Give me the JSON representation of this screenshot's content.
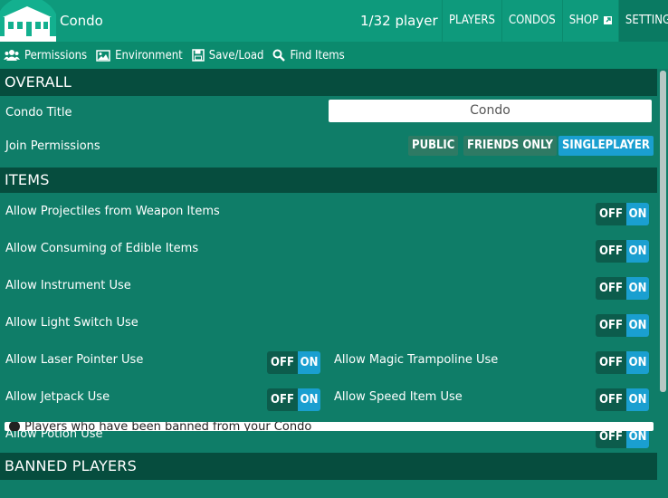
{
  "header": {
    "brand": "Condo",
    "player_count": "1/32 player",
    "nav": [
      "PLAYERS",
      "CONDOS",
      "SHOP",
      "SETTINGS"
    ]
  },
  "tabs": [
    {
      "icon": "users-icon",
      "label": "Permissions"
    },
    {
      "icon": "image-icon",
      "label": "Environment"
    },
    {
      "icon": "save-icon",
      "label": "Save/Load"
    },
    {
      "icon": "search-icon",
      "label": "Find Items"
    }
  ],
  "sections": {
    "overall": "OVERALL",
    "items": "ITEMS",
    "banned": "BANNED PLAYERS"
  },
  "overall": {
    "condo_title_label": "Condo Title",
    "condo_title_value": "Condo",
    "join_label": "Join Permissions",
    "join_options": [
      "PUBLIC",
      "FRIENDS ONLY",
      "SINGLEPLAYER"
    ],
    "join_selected": "SINGLEPLAYER"
  },
  "items": [
    {
      "label": "Allow Projectiles from Weapon Items",
      "state": "ON"
    },
    {
      "label": "Allow Consuming of Edible Items",
      "state": "ON"
    },
    {
      "label": "Allow Instrument Use",
      "state": "ON"
    },
    {
      "label": "Allow Light Switch Use",
      "state": "ON"
    },
    {
      "label": "Allow Laser Pointer Use",
      "state": "ON"
    },
    {
      "label": "Allow Magic Trampoline Use",
      "state": "ON"
    },
    {
      "label": "Allow Jetpack Use",
      "state": "ON"
    },
    {
      "label": "Allow Speed Item Use",
      "state": "ON"
    },
    {
      "label": "Allow Potion Use",
      "state": "ON"
    }
  ],
  "toggle_labels": {
    "off": "OFF",
    "on": "ON"
  },
  "banned_text": "Players who have been banned from your Condo",
  "colors": {
    "bg": "#0f7d68",
    "header": "#0e9a7c",
    "section": "#064d3e",
    "accent": "#1a9fd0",
    "button": "#2e7a64"
  }
}
